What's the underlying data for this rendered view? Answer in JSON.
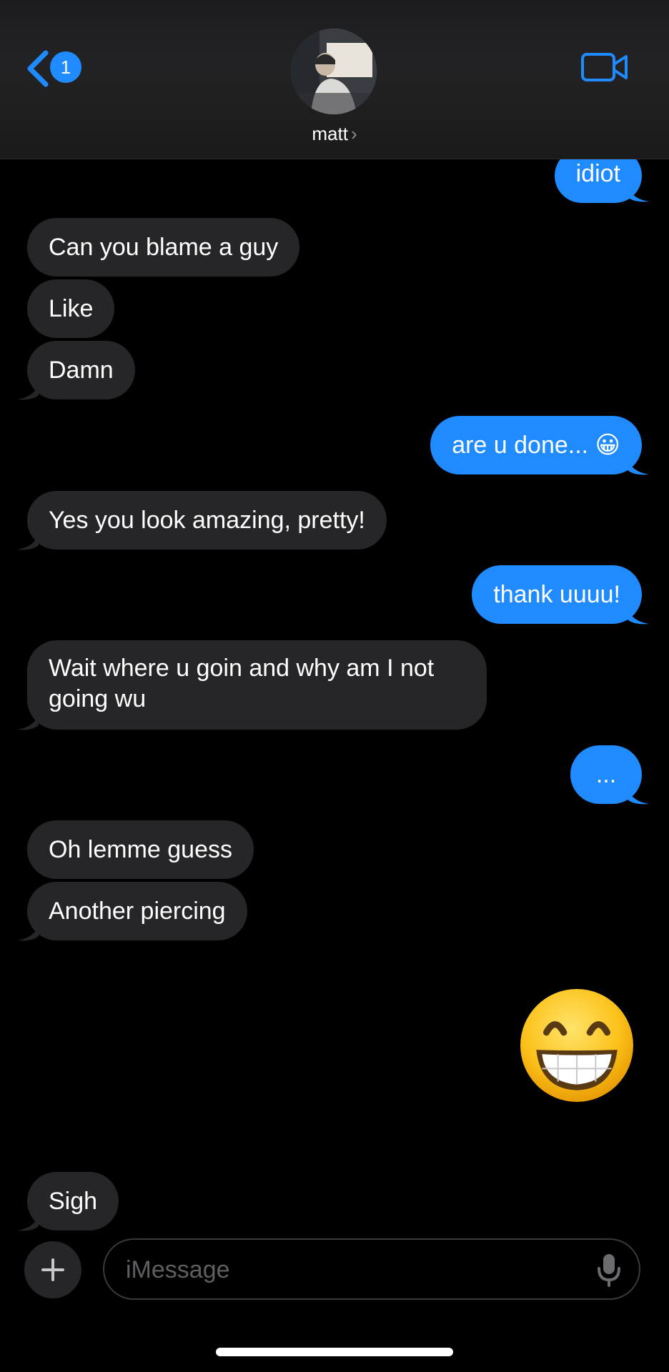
{
  "header": {
    "back_badge_count": "1",
    "contact_name": "matt",
    "chevron_glyph": "›"
  },
  "messages": [
    {
      "id": "m1",
      "direction": "out",
      "text": "idiot"
    },
    {
      "id": "m2",
      "direction": "in",
      "text": "Can you blame a guy"
    },
    {
      "id": "m3",
      "direction": "in",
      "text": "Like"
    },
    {
      "id": "m4",
      "direction": "in",
      "text": "Damn"
    },
    {
      "id": "m5",
      "direction": "out",
      "text": "are u done... 😀"
    },
    {
      "id": "m6",
      "direction": "in",
      "text": "Yes you look amazing, pretty!"
    },
    {
      "id": "m7",
      "direction": "out",
      "text": "thank uuuu!"
    },
    {
      "id": "m8",
      "direction": "in",
      "text": "Wait where u goin and why am I not going wu"
    },
    {
      "id": "m9",
      "direction": "out",
      "text": "..."
    },
    {
      "id": "m10",
      "direction": "in",
      "text": "Oh lemme guess"
    },
    {
      "id": "m11",
      "direction": "in",
      "text": "Another piercing"
    },
    {
      "id": "m12",
      "direction": "out",
      "text": "😁",
      "kind": "big-emoji"
    },
    {
      "id": "m13",
      "direction": "in",
      "text": "Sigh"
    }
  ],
  "composer": {
    "placeholder": "iMessage",
    "value": ""
  },
  "colors": {
    "outgoing_bubble": "#1f8bff",
    "incoming_bubble": "#262629",
    "background": "#000000",
    "accent": "#1f8bff"
  },
  "icons": {
    "back": "chevron-left-icon",
    "video": "video-camera-icon",
    "plus": "plus-icon",
    "mic": "microphone-icon"
  }
}
